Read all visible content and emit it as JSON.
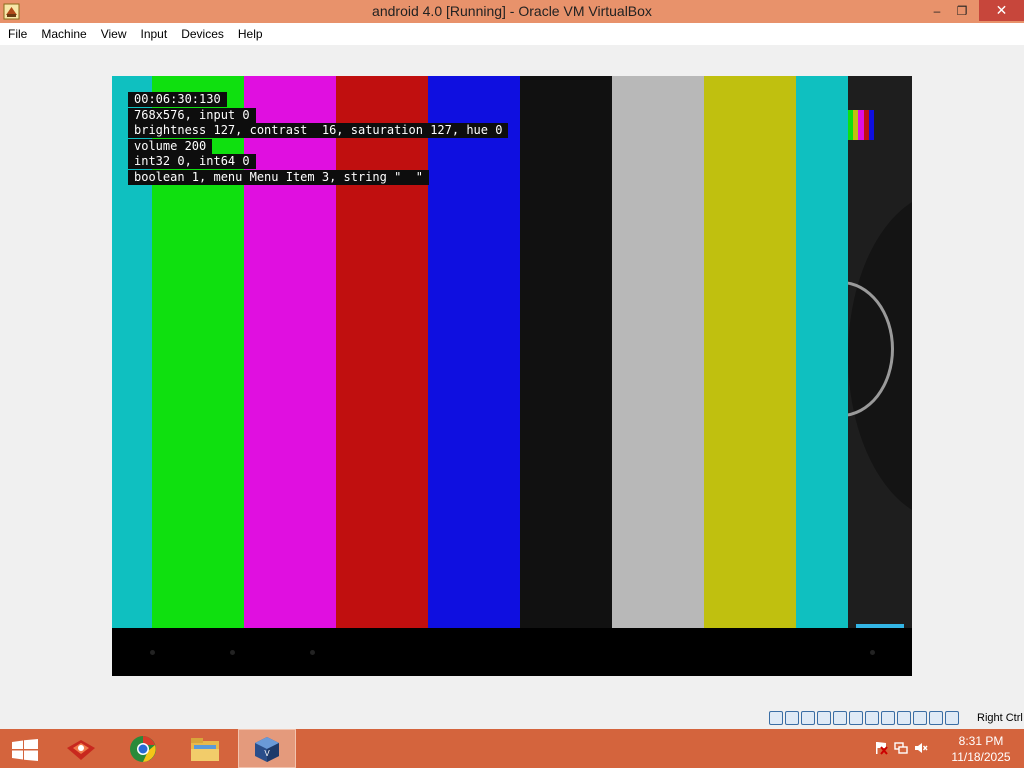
{
  "window": {
    "title": "android 4.0 [Running] - Oracle VM VirtualBox",
    "controls": {
      "minimize": "–",
      "maximize": "❐",
      "close": "✕"
    }
  },
  "menu": {
    "items": [
      "File",
      "Machine",
      "View",
      "Input",
      "Devices",
      "Help"
    ]
  },
  "guest": {
    "color_bars": [
      "#0fc0c0",
      "#0fe00f",
      "#e00fe0",
      "#c00f0f",
      "#0f0fe0",
      "#111111",
      "#b8b8b8",
      "#c0c00f",
      "#0fc0c0"
    ],
    "osd_lines": [
      "00:06:30:130",
      "768x576, input 0",
      "brightness 127, contrast  16, saturation 127, hue 0",
      "volume 200",
      "int32 0, int64 0",
      "boolean 1, menu Menu Item 3, string \"  \""
    ],
    "thumbnail_colors": [
      "#0fe00f",
      "#c0c00f",
      "#e00fe0",
      "#c00f0f",
      "#0f0fe0"
    ]
  },
  "statusbar": {
    "host_key": "Right Ctrl"
  },
  "taskbar": {
    "apps": [
      "app-red-icon",
      "chrome-icon",
      "file-explorer-icon",
      "virtualbox-icon"
    ],
    "tray_icons": [
      "flag-icon",
      "network-icon",
      "volume-muted-icon"
    ],
    "time": "8:31 PM",
    "date": "11/18/2025"
  }
}
